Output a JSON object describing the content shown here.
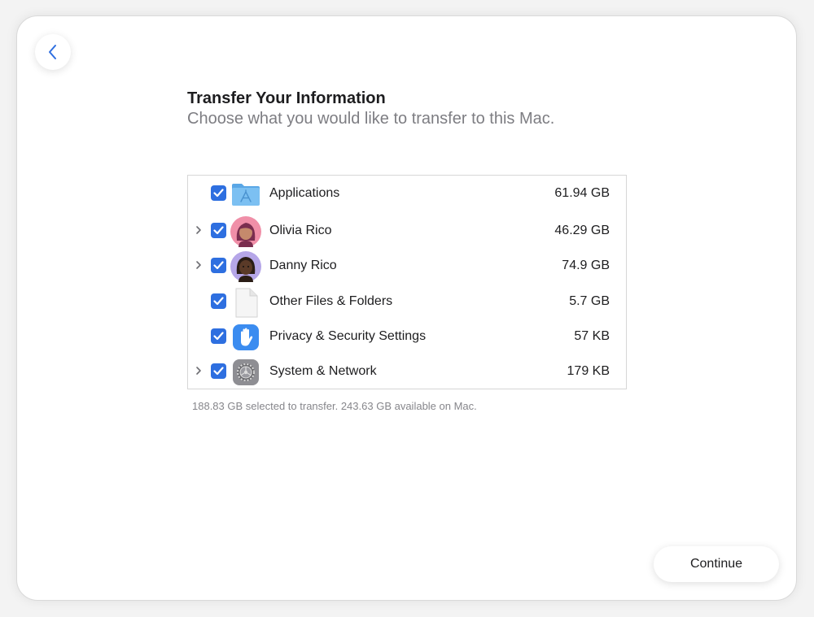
{
  "header": {
    "title": "Transfer Your Information",
    "subtitle": "Choose what you would like to transfer to this Mac."
  },
  "items": [
    {
      "label": "Applications",
      "size": "61.94 GB",
      "checked": true,
      "expandable": false,
      "icon": "applications-folder-icon"
    },
    {
      "label": "Olivia Rico",
      "size": "46.29 GB",
      "checked": true,
      "expandable": true,
      "icon": "olivia-memoji-avatar"
    },
    {
      "label": "Danny Rico",
      "size": "74.9 GB",
      "checked": true,
      "expandable": true,
      "icon": "danny-memoji-avatar"
    },
    {
      "label": "Other Files & Folders",
      "size": "5.7 GB",
      "checked": true,
      "expandable": false,
      "icon": "document-icon"
    },
    {
      "label": "Privacy & Security Settings",
      "size": "57 KB",
      "checked": true,
      "expandable": false,
      "icon": "privacy-hand-icon"
    },
    {
      "label": "System & Network",
      "size": "179 KB",
      "checked": true,
      "expandable": true,
      "icon": "system-gear-icon"
    }
  ],
  "status_text": "188.83 GB selected to transfer. 243.63 GB available on Mac.",
  "buttons": {
    "continue": "Continue"
  },
  "colors": {
    "accent": "#2e6fe0",
    "back_chevron": "#2f6fe0"
  }
}
